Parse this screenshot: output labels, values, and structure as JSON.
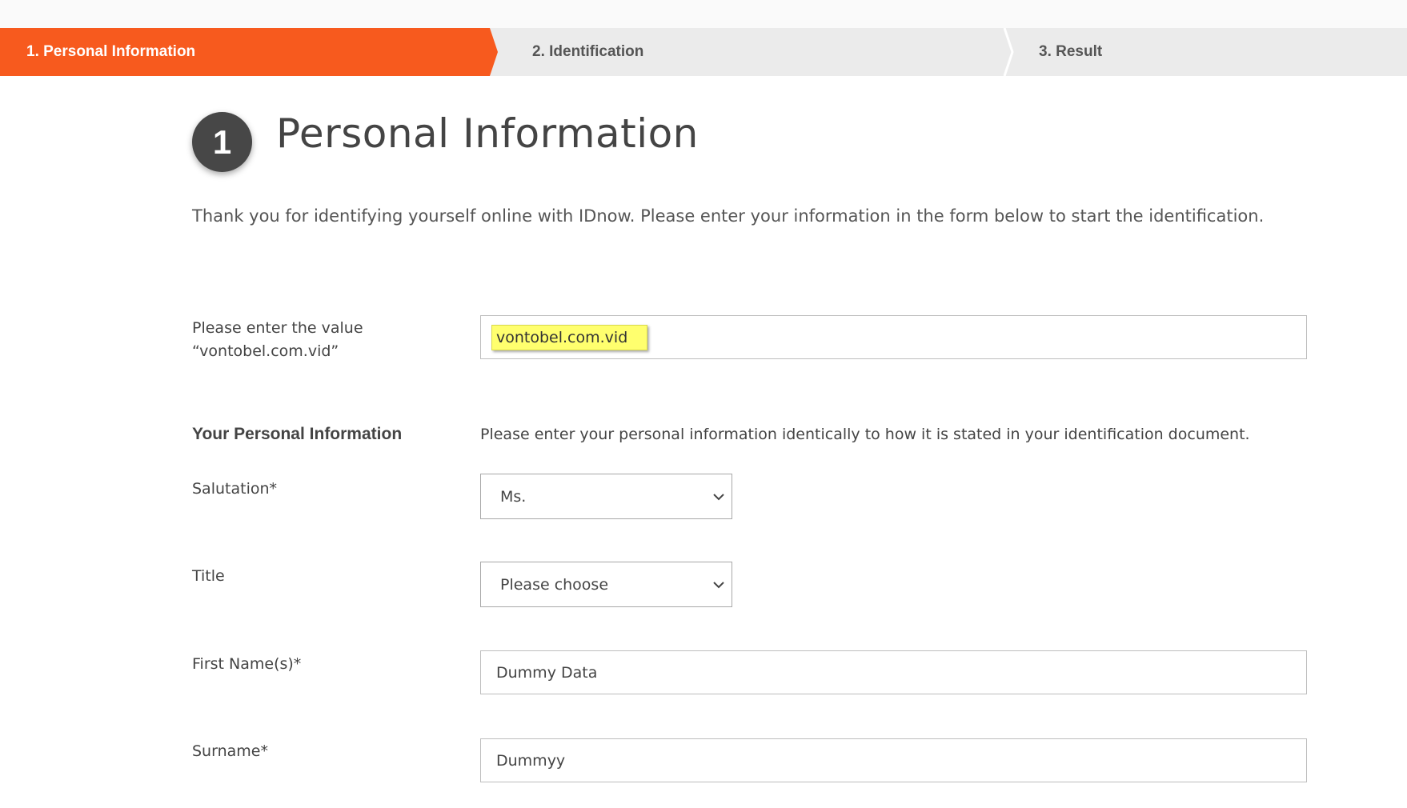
{
  "stepper": {
    "steps": [
      {
        "label": "1. Personal Information",
        "active": true
      },
      {
        "label": "2. Identification",
        "active": false
      },
      {
        "label": "3. Result",
        "active": false
      }
    ],
    "active_color": "#f75a1e",
    "inactive_color": "#ebebeb"
  },
  "heading": {
    "number": "1",
    "title": "Personal Information"
  },
  "intro_text": "Thank you for identifying yourself online with IDnow. Please enter your information in the form below to start the identification.",
  "form": {
    "value_check": {
      "label_line1": "Please enter the value",
      "label_line2": "“vontobel.com.vid”",
      "value": "vontobel.com.vid",
      "highlight_color": "#ffff6e"
    },
    "section": {
      "title": "Your Personal Information",
      "hint": "Please enter your personal information identically to how it is stated in your identification document."
    },
    "salutation": {
      "label": "Salutation*",
      "selected": "Ms."
    },
    "title": {
      "label": "Title",
      "selected": "Please choose"
    },
    "first_name": {
      "label": "First Name(s)*",
      "value": "Dummy Data"
    },
    "surname": {
      "label": "Surname*",
      "value": "Dummyy"
    }
  },
  "icons": {
    "select_arrow": "chevron-down-icon"
  }
}
